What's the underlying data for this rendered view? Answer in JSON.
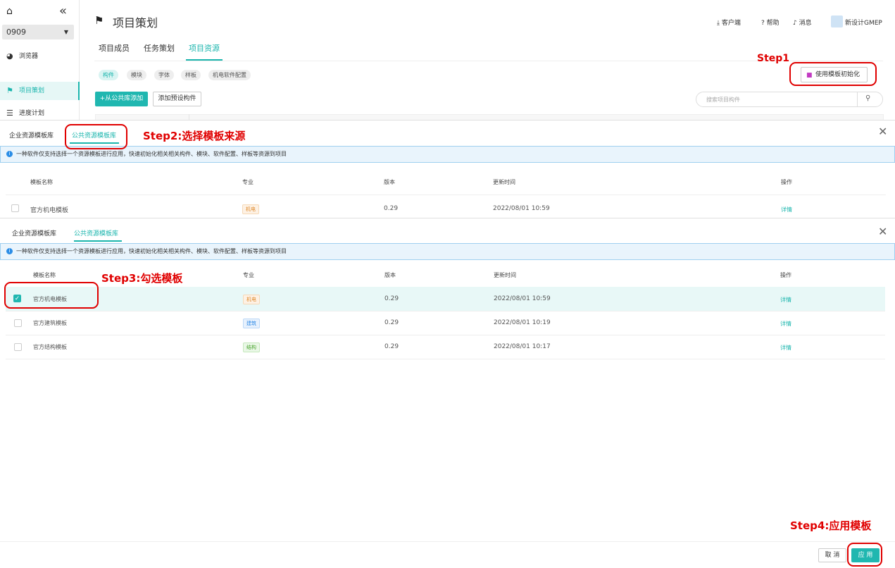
{
  "colors": {
    "accent": "#1ab5ad",
    "annotation": "#e00000",
    "info_bg": "#e9f4fc"
  },
  "sidebar": {
    "home_icon": "home-icon",
    "collapse_icon": "double-chevron-left-icon",
    "project_select": {
      "value": "0909"
    },
    "items": [
      {
        "label": "浏览器",
        "icon": "browser-icon",
        "active": false
      },
      {
        "label": "项目策划",
        "icon": "flag-icon",
        "active": true
      },
      {
        "label": "进度计划",
        "icon": "gantt-icon",
        "active": false
      }
    ]
  },
  "header": {
    "title": "项目策划",
    "client": "客户端",
    "help": "帮助",
    "messages": "消息",
    "user": "新设计GMEP"
  },
  "tabs": [
    "项目成员",
    "任务策划",
    "项目资源"
  ],
  "active_tab": "项目资源",
  "chips": [
    "构件",
    "模块",
    "字体",
    "样板",
    "机电软件配置"
  ],
  "active_chip": "构件",
  "toolbar": {
    "init_button": "使用模板初始化",
    "add_from_public": "+从公共库添加",
    "add_preset": "添加预设构件",
    "search_placeholder": "搜索项目构件"
  },
  "modal1": {
    "tabs": [
      "企业资源模板库",
      "公共资源模板库"
    ],
    "active_tab": "公共资源模板库",
    "info": "一种软件仅支持选择一个资源模板进行应用，快速初始化相关相关构件、模块、软件配置、样板等资源到项目",
    "columns": [
      "模板名称",
      "专业",
      "版本",
      "更新时间",
      "操作"
    ],
    "rows": [
      {
        "name": "官方机电模板",
        "discipline": "机电",
        "version": "0.29",
        "updated": "2022/08/01 10:59",
        "action": "详情",
        "checked": false
      }
    ]
  },
  "modal2": {
    "tabs": [
      "企业资源模板库",
      "公共资源模板库"
    ],
    "active_tab": "公共资源模板库",
    "info": "一种软件仅支持选择一个资源模板进行应用，快速初始化相关相关构件、模块、软件配置、样板等资源到项目",
    "columns": [
      "模板名称",
      "专业",
      "版本",
      "更新时间",
      "操作"
    ],
    "rows": [
      {
        "name": "官方机电模板",
        "discipline": "机电",
        "version": "0.29",
        "updated": "2022/08/01 10:59",
        "action": "详情",
        "checked": true
      },
      {
        "name": "官方建筑模板",
        "discipline": "建筑",
        "version": "0.29",
        "updated": "2022/08/01 10:19",
        "action": "详情",
        "checked": false
      },
      {
        "name": "官方结构模板",
        "discipline": "结构",
        "version": "0.29",
        "updated": "2022/08/01 10:17",
        "action": "详情",
        "checked": false
      }
    ],
    "footer": {
      "cancel": "取 消",
      "apply": "应 用"
    }
  },
  "annotations": {
    "step1": "Step1",
    "step2": "Step2:选择模板来源",
    "step3": "Step3:勾选模板",
    "step4": "Step4:应用模板"
  }
}
